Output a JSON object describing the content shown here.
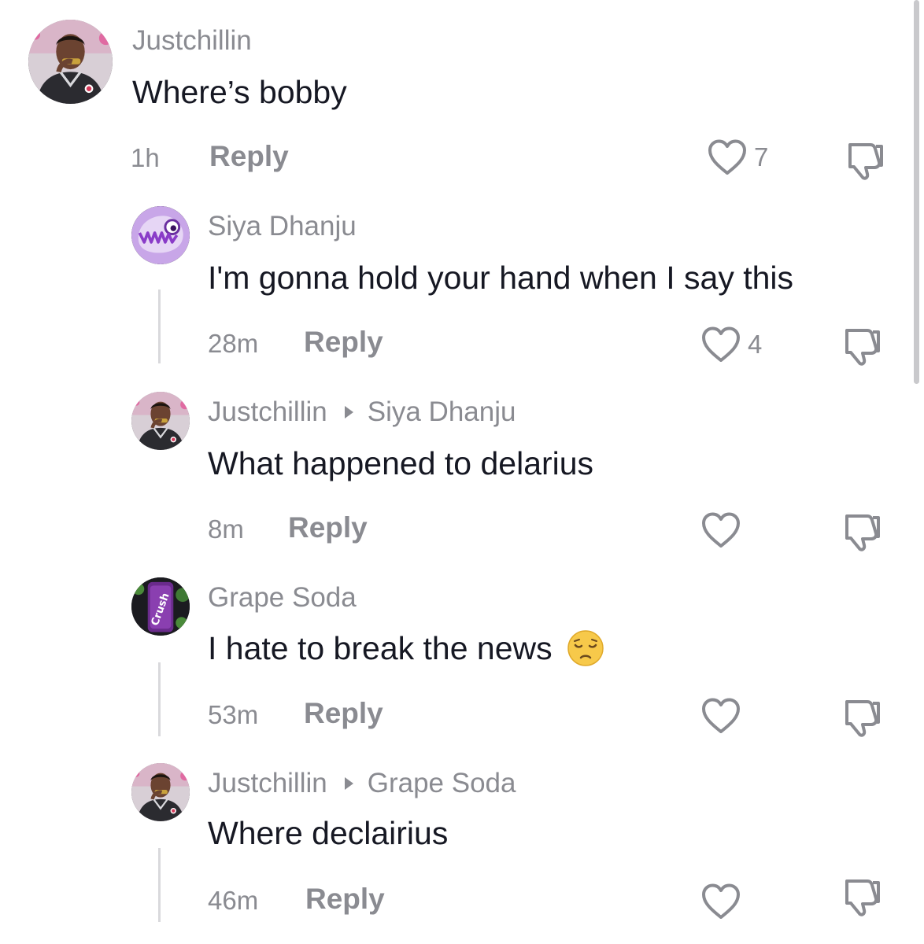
{
  "comments": [
    {
      "username": "Justchillin",
      "reply_to": "",
      "text": "Where’s bobby",
      "time": "1h",
      "reply_label": "Reply",
      "likes": "7",
      "avatar_icon": "athlete-avatar-icon"
    },
    {
      "username": "Siya Dhanju",
      "reply_to": "",
      "text": "I'm gonna hold your hand when I say this",
      "time": "28m",
      "reply_label": "Reply",
      "likes": "4",
      "avatar_icon": "purple-monster-avatar-icon"
    },
    {
      "username": "Justchillin",
      "reply_to": "Siya Dhanju",
      "text": "What happened to delarius",
      "time": "8m",
      "reply_label": "Reply",
      "likes": "",
      "avatar_icon": "athlete-avatar-icon"
    },
    {
      "username": "Grape Soda",
      "reply_to": "",
      "text": "I hate to break the news",
      "emoji": "pensive-face-emoji",
      "time": "53m",
      "reply_label": "Reply",
      "likes": "",
      "avatar_icon": "grape-soda-can-avatar-icon"
    },
    {
      "username": "Justchillin",
      "reply_to": "Grape Soda",
      "text": "Where declairius",
      "time": "46m",
      "reply_label": "Reply",
      "likes": "",
      "avatar_icon": "athlete-avatar-icon"
    }
  ],
  "colors": {
    "text_primary": "#161823",
    "text_secondary": "#8a8b91",
    "thread_line": "#d9d9dc"
  }
}
